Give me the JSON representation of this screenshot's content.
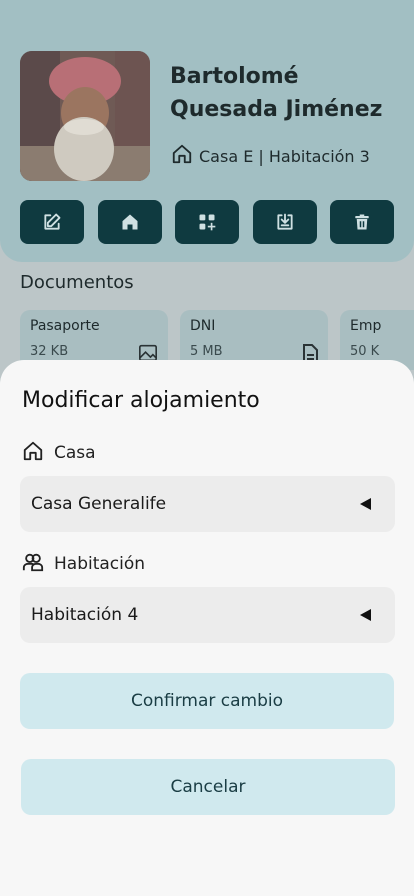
{
  "profile": {
    "name_line1": "Bartolomé",
    "name_line2": "Quesada Jiménez",
    "location": "Casa E | Habitación 3"
  },
  "actions": [
    {
      "icon": "edit-icon"
    },
    {
      "icon": "home-icon"
    },
    {
      "icon": "apps-add-icon"
    },
    {
      "icon": "download-box-icon"
    },
    {
      "icon": "trash-icon"
    }
  ],
  "documents": {
    "title": "Documentos",
    "items": [
      {
        "name": "Pasaporte",
        "size": "32 KB",
        "icon": "image-icon"
      },
      {
        "name": "DNI",
        "size": "5 MB",
        "icon": "document-icon"
      },
      {
        "name": "Emp",
        "size": "50 K"
      }
    ]
  },
  "sheet": {
    "title": "Modificar alojamiento",
    "house_label": "Casa",
    "house_value": "Casa Generalife",
    "room_label": "Habitación",
    "room_value": "Habitación 4",
    "confirm_label": "Confirmar cambio",
    "cancel_label": "Cancelar"
  },
  "colors": {
    "action_button": "#0f3a40",
    "sheet_button": "#d0e9ee",
    "sheet_button_text": "#1a3d44"
  }
}
